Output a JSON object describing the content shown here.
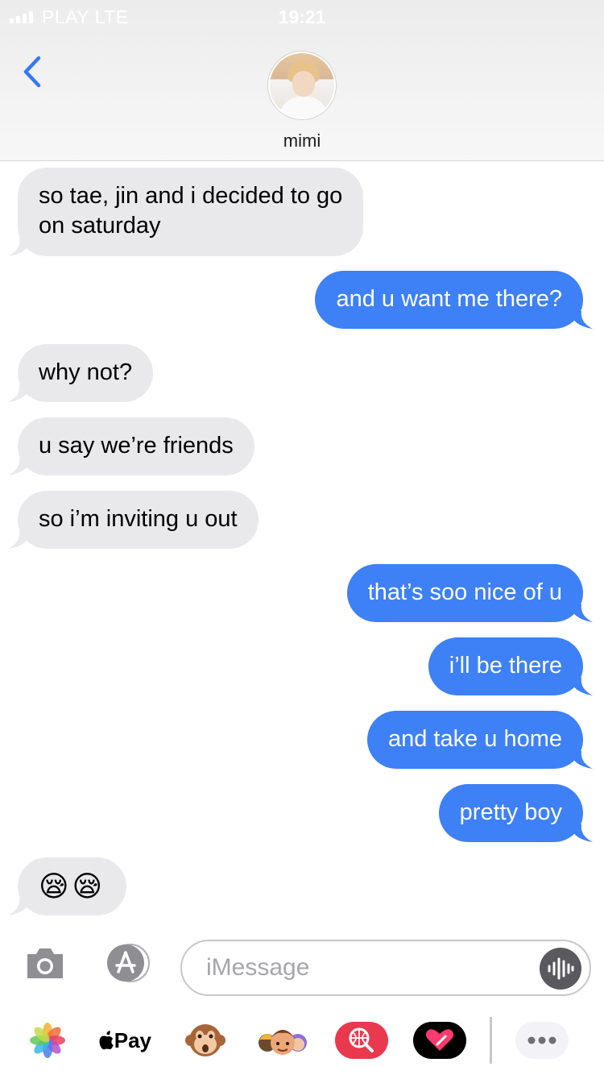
{
  "status_bar": {
    "carrier": "PLAY  LTE",
    "time": "19:21"
  },
  "header": {
    "contact_name": "mimi"
  },
  "messages": [
    {
      "side": "in",
      "text": "so tae, jin and i decided to go\non saturday"
    },
    {
      "side": "out",
      "text": "and u want me there?"
    },
    {
      "side": "in",
      "text": "why not?"
    },
    {
      "side": "in",
      "text": "u say we’re friends"
    },
    {
      "side": "in",
      "text": "so i’m inviting u out"
    },
    {
      "side": "out",
      "text": "that’s soo nice of u"
    },
    {
      "side": "out",
      "text": "i’ll be there"
    },
    {
      "side": "out",
      "text": "and take u home"
    },
    {
      "side": "out",
      "text": "pretty boy"
    },
    {
      "side": "in",
      "text": "😪😪"
    }
  ],
  "composer": {
    "placeholder": "iMessage"
  },
  "app_drawer": {
    "apps": [
      "photos-app",
      "apple-pay",
      "monkey-animoji",
      "memoji-stickers",
      "web-search-app",
      "digital-touch-app",
      "more-apps"
    ],
    "apple_pay_label": "Pay"
  },
  "colors": {
    "outgoing": "#3e80f6",
    "incoming": "#e9e9eb",
    "accent": "#3478f6"
  }
}
